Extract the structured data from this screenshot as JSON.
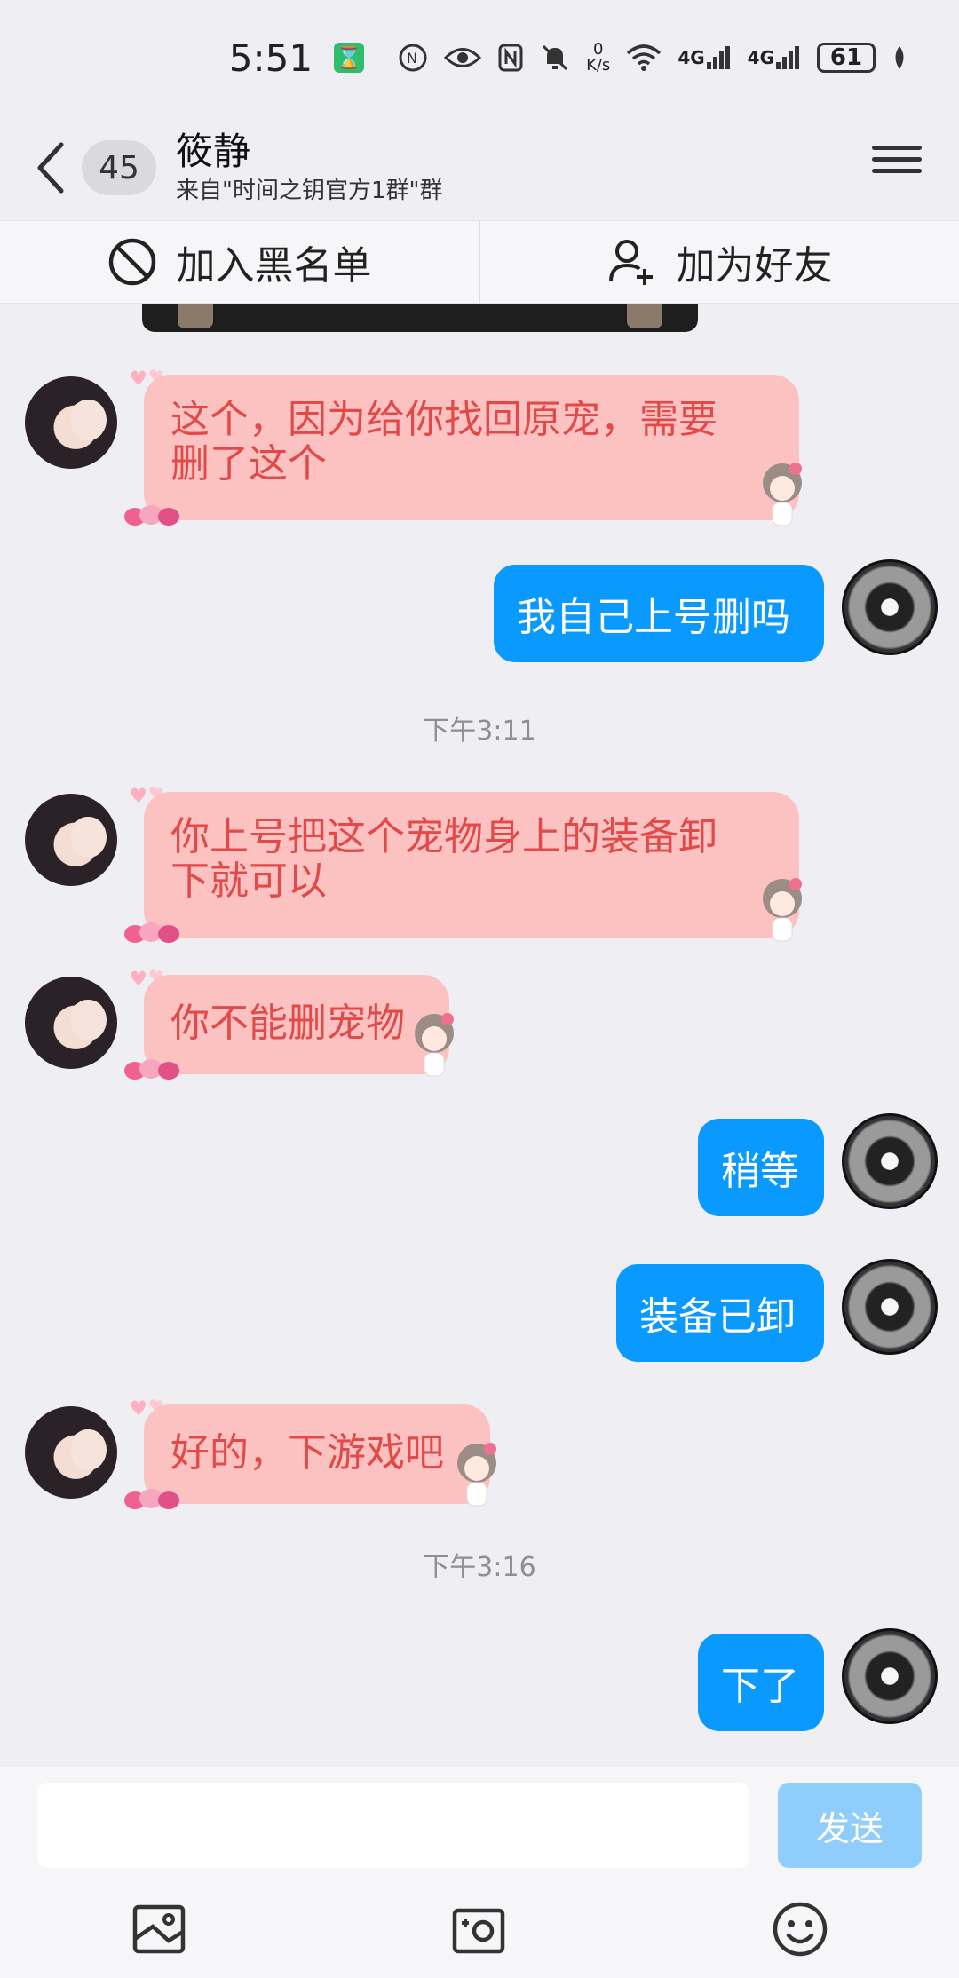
{
  "status_bar": {
    "time": "5:51",
    "speed_value": "0",
    "speed_unit": "K/s",
    "net1": "4G",
    "net2": "4G",
    "battery": "61"
  },
  "header": {
    "badge": "45",
    "name": "筱静",
    "source": "来自\"时间之钥官方1群\"群"
  },
  "actions": {
    "blacklist": "加入黑名单",
    "add_friend": "加为好友"
  },
  "timestamps": [
    "下午3:11",
    "下午3:16"
  ],
  "messages": [
    {
      "side": "left",
      "text_line1": "这个，因为给你找回原宠，需要",
      "text_line2": "删了这个"
    },
    {
      "side": "right",
      "text": "我自己上号删吗"
    },
    {
      "side": "left",
      "text_line1": "你上号把这个宠物身上的装备卸",
      "text_line2": "下就可以"
    },
    {
      "side": "left",
      "text": "你不能删宠物"
    },
    {
      "side": "right",
      "text": "稍等"
    },
    {
      "side": "right",
      "text": "装备已卸"
    },
    {
      "side": "left",
      "text": "好的，下游戏吧"
    },
    {
      "side": "right",
      "text": "下了"
    }
  ],
  "input": {
    "value": "",
    "send_label": "发送"
  },
  "colors": {
    "accent_blue": "#0a99ff",
    "bubble_pink": "#fcc1c1",
    "bubble_pink_text": "#e24a4a",
    "send_disabled": "#8fcdfc"
  },
  "icons": [
    "hourglass-icon",
    "nfc-icon",
    "eye-icon",
    "mute-icon",
    "wifi-icon",
    "signal-icon",
    "battery-icon",
    "leaf-icon",
    "back-icon",
    "menu-icon",
    "block-icon",
    "add-user-icon",
    "image-icon",
    "camera-icon",
    "emoji-icon"
  ]
}
